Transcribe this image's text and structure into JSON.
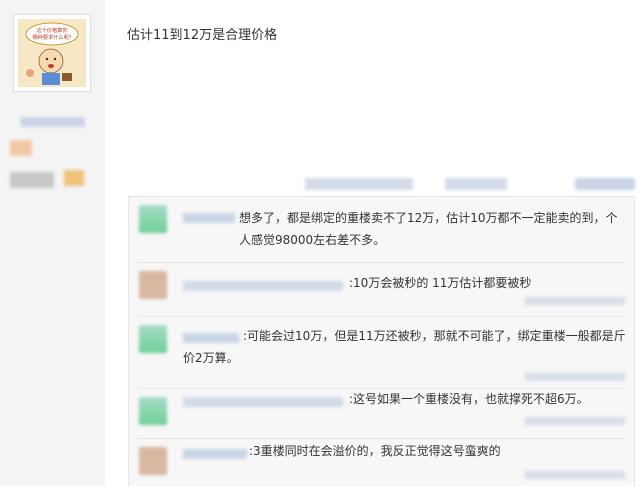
{
  "post": {
    "text": "估计11到12万是合理价格",
    "avatar_caption": "这个价格算你\n哪种要求什么呢?"
  },
  "comments": [
    {
      "text": "想多了，都是绑定的重楼卖不了12万，估计10万都不一定能卖的到，个人感觉98000左右差不多。"
    },
    {
      "text": ":10万会被秒的 11万估计都要被秒"
    },
    {
      "text": ":可能会过10万，但是11万还被秒，那就不可能了，绑定重楼一般都是斤价2万算。"
    },
    {
      "text": ":这号如果一个重楼没有，也就撑死不超6万。"
    },
    {
      "text": ":3重楼同时在会溢价的，我反正觉得这号蛮爽的"
    }
  ],
  "colors": {
    "sidebar_bg": "#f4f4f4",
    "comment_bg": "#f7f7f7",
    "text": "#333333",
    "blurred_link": "#c9d4e6"
  }
}
